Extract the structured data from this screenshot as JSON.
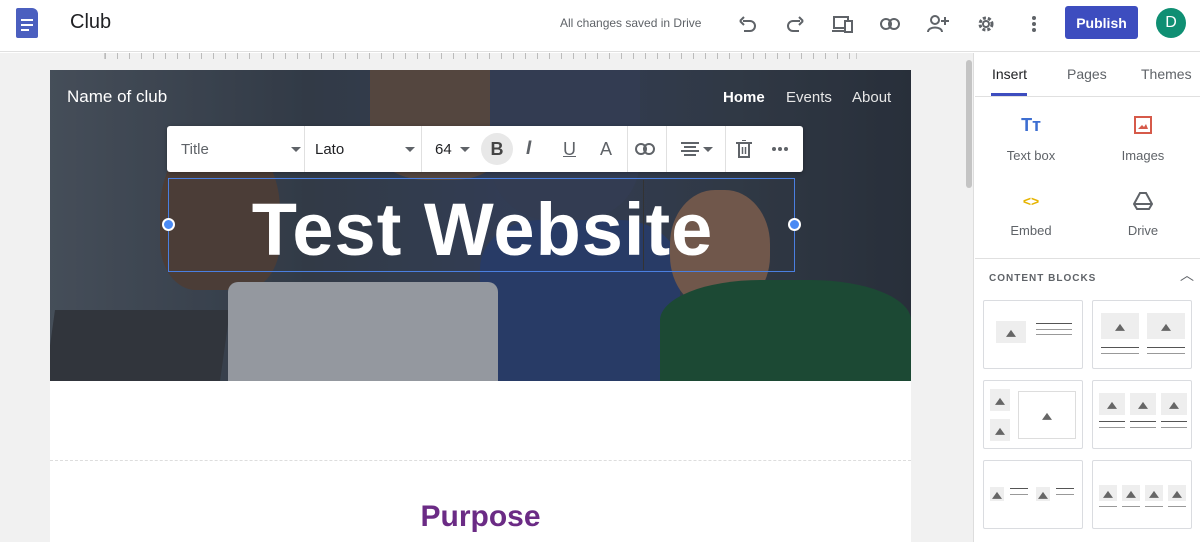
{
  "app": {
    "doc_title": "Club",
    "save_status": "All changes saved in Drive",
    "publish_label": "Publish",
    "avatar_initial": "D",
    "accent": "#3d4dbf"
  },
  "toolbar_icons": [
    "undo-icon",
    "redo-icon",
    "preview-icon",
    "link-icon",
    "share-icon",
    "settings-icon",
    "more-vert-icon"
  ],
  "site": {
    "name": "Name of club",
    "nav": [
      "Home",
      "Events",
      "About"
    ],
    "hero_title": "Test Website",
    "section_heading": "Purpose",
    "heading_color": "#6b2b85"
  },
  "format_bar": {
    "style": "Title",
    "font": "Lato",
    "size": "64",
    "buttons": [
      "bold-icon",
      "italic-icon",
      "underline-icon",
      "text-color-icon",
      "link-icon",
      "align-icon",
      "delete-icon",
      "more-icon"
    ]
  },
  "sidebar": {
    "tabs": [
      "Insert",
      "Pages",
      "Themes"
    ],
    "insert_items": [
      {
        "label": "Text box",
        "icon": "text-box-icon"
      },
      {
        "label": "Images",
        "icon": "image-icon"
      },
      {
        "label": "Embed",
        "icon": "embed-icon"
      },
      {
        "label": "Drive",
        "icon": "drive-icon"
      }
    ],
    "content_blocks_title": "CONTENT BLOCKS"
  }
}
